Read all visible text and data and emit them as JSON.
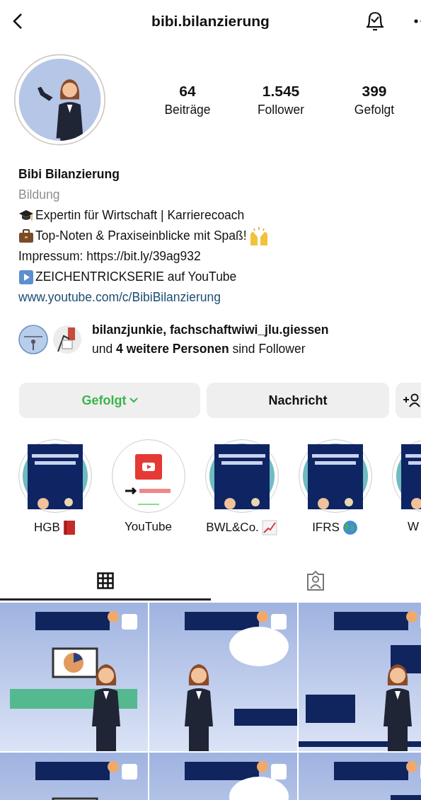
{
  "header": {
    "username": "bibi.bilanzierung"
  },
  "profile": {
    "stats": [
      {
        "value": "64",
        "label": "Beiträge"
      },
      {
        "value": "1.545",
        "label": "Follower"
      },
      {
        "value": "399",
        "label": "Gefolgt"
      }
    ]
  },
  "bio": {
    "name": "Bibi Bilanzierung",
    "category": "Bildung",
    "lines": [
      {
        "text": "Expertin für Wirtschaft | Karrierecoach"
      },
      {
        "text": "Top-Noten & Praxiseinblicke mit Spaß!"
      },
      {
        "text": "Impressum: https://bit.ly/39ag932"
      },
      {
        "text": "ZEICHENTRICKSERIE auf YouTube"
      }
    ],
    "link": "www.youtube.com/c/BibiBilanzierung"
  },
  "followed_by": {
    "lines": [
      "**bilanzjunkie, fachschaftwiwi_jlu.giessen**",
      "und **4 weitere Personen** sind Follower"
    ]
  },
  "actions": [
    {
      "kind": "follow",
      "label": "Gefolgt",
      "following": true
    },
    {
      "kind": "message",
      "label": "Nachricht"
    },
    {
      "kind": "suggest"
    }
  ],
  "highlights": [
    {
      "label": "HGB"
    },
    {
      "label": "YouTube"
    },
    {
      "label": "BWL&Co."
    },
    {
      "label": "IFRS"
    },
    {
      "label": "W"
    }
  ],
  "tabs": [
    {
      "kind": "grid",
      "selected": true
    },
    {
      "kind": "tagged",
      "selected": false
    }
  ]
}
